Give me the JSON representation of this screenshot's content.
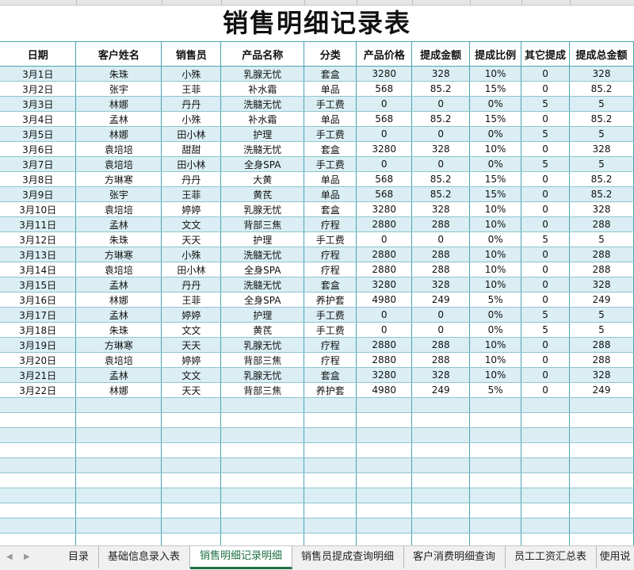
{
  "sheet": {
    "title": "销售明细记录表",
    "headers": [
      "日期",
      "客户姓名",
      "销售员",
      "产品名称",
      "分类",
      "产品价格",
      "提成金额",
      "提成比例",
      "其它提成",
      "提成总金额"
    ],
    "rows": [
      [
        "3月1日",
        "朱珠",
        "小殊",
        "乳腺无忧",
        "套盒",
        "3280",
        "328",
        "10%",
        "0",
        "328"
      ],
      [
        "3月2日",
        "张宇",
        "王菲",
        "补水霜",
        "单品",
        "568",
        "85.2",
        "15%",
        "0",
        "85.2"
      ],
      [
        "3月3日",
        "林娜",
        "丹丹",
        "洗髓无忧",
        "手工费",
        "0",
        "0",
        "0%",
        "5",
        "5"
      ],
      [
        "3月4日",
        "孟林",
        "小殊",
        "补水霜",
        "单品",
        "568",
        "85.2",
        "15%",
        "0",
        "85.2"
      ],
      [
        "3月5日",
        "林娜",
        "田小林",
        "护理",
        "手工费",
        "0",
        "0",
        "0%",
        "5",
        "5"
      ],
      [
        "3月6日",
        "袁培培",
        "甜甜",
        "洗髓无忧",
        "套盒",
        "3280",
        "328",
        "10%",
        "0",
        "328"
      ],
      [
        "3月7日",
        "袁培培",
        "田小林",
        "全身SPA",
        "手工费",
        "0",
        "0",
        "0%",
        "5",
        "5"
      ],
      [
        "3月8日",
        "方琳寒",
        "丹丹",
        "大黄",
        "单品",
        "568",
        "85.2",
        "15%",
        "0",
        "85.2"
      ],
      [
        "3月9日",
        "张宇",
        "王菲",
        "黄芪",
        "单品",
        "568",
        "85.2",
        "15%",
        "0",
        "85.2"
      ],
      [
        "3月10日",
        "袁培培",
        "婷婷",
        "乳腺无忧",
        "套盒",
        "3280",
        "328",
        "10%",
        "0",
        "328"
      ],
      [
        "3月11日",
        "孟林",
        "文文",
        "背部三焦",
        "疗程",
        "2880",
        "288",
        "10%",
        "0",
        "288"
      ],
      [
        "3月12日",
        "朱珠",
        "天天",
        "护理",
        "手工费",
        "0",
        "0",
        "0%",
        "5",
        "5"
      ],
      [
        "3月13日",
        "方琳寒",
        "小殊",
        "洗髓无忧",
        "疗程",
        "2880",
        "288",
        "10%",
        "0",
        "288"
      ],
      [
        "3月14日",
        "袁培培",
        "田小林",
        "全身SPA",
        "疗程",
        "2880",
        "288",
        "10%",
        "0",
        "288"
      ],
      [
        "3月15日",
        "孟林",
        "丹丹",
        "洗髓无忧",
        "套盒",
        "3280",
        "328",
        "10%",
        "0",
        "328"
      ],
      [
        "3月16日",
        "林娜",
        "王菲",
        "全身SPA",
        "养护套",
        "4980",
        "249",
        "5%",
        "0",
        "249"
      ],
      [
        "3月17日",
        "孟林",
        "婷婷",
        "护理",
        "手工费",
        "0",
        "0",
        "0%",
        "5",
        "5"
      ],
      [
        "3月18日",
        "朱珠",
        "文文",
        "黄芪",
        "手工费",
        "0",
        "0",
        "0%",
        "5",
        "5"
      ],
      [
        "3月19日",
        "方琳寒",
        "天天",
        "乳腺无忧",
        "疗程",
        "2880",
        "288",
        "10%",
        "0",
        "288"
      ],
      [
        "3月20日",
        "袁培培",
        "婷婷",
        "背部三焦",
        "疗程",
        "2880",
        "288",
        "10%",
        "0",
        "288"
      ],
      [
        "3月21日",
        "孟林",
        "文文",
        "乳腺无忧",
        "套盒",
        "3280",
        "328",
        "10%",
        "0",
        "328"
      ],
      [
        "3月22日",
        "林娜",
        "天天",
        "背部三焦",
        "养护套",
        "4980",
        "249",
        "5%",
        "0",
        "249"
      ]
    ],
    "empty_rows": 10
  },
  "tabs": {
    "items": [
      "目录",
      "基础信息录入表",
      "销售明细记录明细",
      "销售员提成查询明细",
      "客户消费明细查询",
      "员工工资汇总表",
      "使用说"
    ],
    "active_index": 2
  },
  "colors": {
    "band": "#daeef3",
    "grid": "#4aa3b5",
    "active_tab": "#1e7145"
  }
}
